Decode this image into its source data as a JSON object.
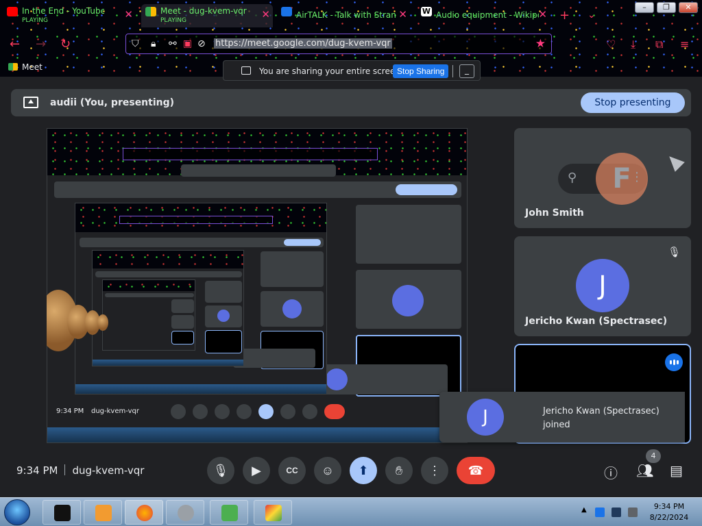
{
  "browser": {
    "tabs": [
      {
        "title": "In the End - YouTube",
        "subtitle": "PLAYING",
        "favicon": "youtube-icon",
        "active": false
      },
      {
        "title": "Meet - dug-kvem-vqr",
        "subtitle": "PLAYING",
        "favicon": "meet-icon",
        "active": true
      },
      {
        "title": "AirTALK - Talk with Strange",
        "subtitle": "",
        "favicon": "chat-icon",
        "active": false
      },
      {
        "title": "Audio equipment - Wikipe",
        "subtitle": "",
        "favicon": "wikipedia-icon",
        "active": false
      }
    ],
    "url": "https://meet.google.com/dug-kvem-vqr",
    "app_label": "Meet",
    "accent_color": "#ff3b5f"
  },
  "share_bar": {
    "text": "You are sharing your entire screen.",
    "stop_label": "Stop Sharing",
    "minimize_label": "_"
  },
  "presenting": {
    "label": "audii (You, presenting)",
    "stop_label": "Stop presenting"
  },
  "participants": [
    {
      "name": "John Smith",
      "initial": "F"
    },
    {
      "name": "Jericho Kwan (Spectrasec)",
      "initial": "J"
    }
  ],
  "toast": {
    "initial": "J",
    "name": "Jericho Kwan (Spectrasec)",
    "status": "joined"
  },
  "meeting": {
    "time": "9:34 PM",
    "code": "dug-kvem-vqr",
    "people_count": "4"
  },
  "taskbar": {
    "time": "9:34 PM",
    "date": "8/22/2024"
  }
}
